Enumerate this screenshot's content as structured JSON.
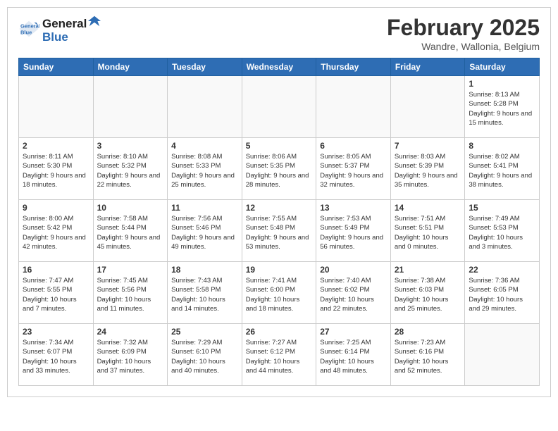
{
  "header": {
    "logo_line1": "General",
    "logo_line2": "Blue",
    "month_title": "February 2025",
    "location": "Wandre, Wallonia, Belgium"
  },
  "weekdays": [
    "Sunday",
    "Monday",
    "Tuesday",
    "Wednesday",
    "Thursday",
    "Friday",
    "Saturday"
  ],
  "weeks": [
    [
      {
        "day": "",
        "info": ""
      },
      {
        "day": "",
        "info": ""
      },
      {
        "day": "",
        "info": ""
      },
      {
        "day": "",
        "info": ""
      },
      {
        "day": "",
        "info": ""
      },
      {
        "day": "",
        "info": ""
      },
      {
        "day": "1",
        "info": "Sunrise: 8:13 AM\nSunset: 5:28 PM\nDaylight: 9 hours and 15 minutes."
      }
    ],
    [
      {
        "day": "2",
        "info": "Sunrise: 8:11 AM\nSunset: 5:30 PM\nDaylight: 9 hours and 18 minutes."
      },
      {
        "day": "3",
        "info": "Sunrise: 8:10 AM\nSunset: 5:32 PM\nDaylight: 9 hours and 22 minutes."
      },
      {
        "day": "4",
        "info": "Sunrise: 8:08 AM\nSunset: 5:33 PM\nDaylight: 9 hours and 25 minutes."
      },
      {
        "day": "5",
        "info": "Sunrise: 8:06 AM\nSunset: 5:35 PM\nDaylight: 9 hours and 28 minutes."
      },
      {
        "day": "6",
        "info": "Sunrise: 8:05 AM\nSunset: 5:37 PM\nDaylight: 9 hours and 32 minutes."
      },
      {
        "day": "7",
        "info": "Sunrise: 8:03 AM\nSunset: 5:39 PM\nDaylight: 9 hours and 35 minutes."
      },
      {
        "day": "8",
        "info": "Sunrise: 8:02 AM\nSunset: 5:41 PM\nDaylight: 9 hours and 38 minutes."
      }
    ],
    [
      {
        "day": "9",
        "info": "Sunrise: 8:00 AM\nSunset: 5:42 PM\nDaylight: 9 hours and 42 minutes."
      },
      {
        "day": "10",
        "info": "Sunrise: 7:58 AM\nSunset: 5:44 PM\nDaylight: 9 hours and 45 minutes."
      },
      {
        "day": "11",
        "info": "Sunrise: 7:56 AM\nSunset: 5:46 PM\nDaylight: 9 hours and 49 minutes."
      },
      {
        "day": "12",
        "info": "Sunrise: 7:55 AM\nSunset: 5:48 PM\nDaylight: 9 hours and 53 minutes."
      },
      {
        "day": "13",
        "info": "Sunrise: 7:53 AM\nSunset: 5:49 PM\nDaylight: 9 hours and 56 minutes."
      },
      {
        "day": "14",
        "info": "Sunrise: 7:51 AM\nSunset: 5:51 PM\nDaylight: 10 hours and 0 minutes."
      },
      {
        "day": "15",
        "info": "Sunrise: 7:49 AM\nSunset: 5:53 PM\nDaylight: 10 hours and 3 minutes."
      }
    ],
    [
      {
        "day": "16",
        "info": "Sunrise: 7:47 AM\nSunset: 5:55 PM\nDaylight: 10 hours and 7 minutes."
      },
      {
        "day": "17",
        "info": "Sunrise: 7:45 AM\nSunset: 5:56 PM\nDaylight: 10 hours and 11 minutes."
      },
      {
        "day": "18",
        "info": "Sunrise: 7:43 AM\nSunset: 5:58 PM\nDaylight: 10 hours and 14 minutes."
      },
      {
        "day": "19",
        "info": "Sunrise: 7:41 AM\nSunset: 6:00 PM\nDaylight: 10 hours and 18 minutes."
      },
      {
        "day": "20",
        "info": "Sunrise: 7:40 AM\nSunset: 6:02 PM\nDaylight: 10 hours and 22 minutes."
      },
      {
        "day": "21",
        "info": "Sunrise: 7:38 AM\nSunset: 6:03 PM\nDaylight: 10 hours and 25 minutes."
      },
      {
        "day": "22",
        "info": "Sunrise: 7:36 AM\nSunset: 6:05 PM\nDaylight: 10 hours and 29 minutes."
      }
    ],
    [
      {
        "day": "23",
        "info": "Sunrise: 7:34 AM\nSunset: 6:07 PM\nDaylight: 10 hours and 33 minutes."
      },
      {
        "day": "24",
        "info": "Sunrise: 7:32 AM\nSunset: 6:09 PM\nDaylight: 10 hours and 37 minutes."
      },
      {
        "day": "25",
        "info": "Sunrise: 7:29 AM\nSunset: 6:10 PM\nDaylight: 10 hours and 40 minutes."
      },
      {
        "day": "26",
        "info": "Sunrise: 7:27 AM\nSunset: 6:12 PM\nDaylight: 10 hours and 44 minutes."
      },
      {
        "day": "27",
        "info": "Sunrise: 7:25 AM\nSunset: 6:14 PM\nDaylight: 10 hours and 48 minutes."
      },
      {
        "day": "28",
        "info": "Sunrise: 7:23 AM\nSunset: 6:16 PM\nDaylight: 10 hours and 52 minutes."
      },
      {
        "day": "",
        "info": ""
      }
    ]
  ]
}
